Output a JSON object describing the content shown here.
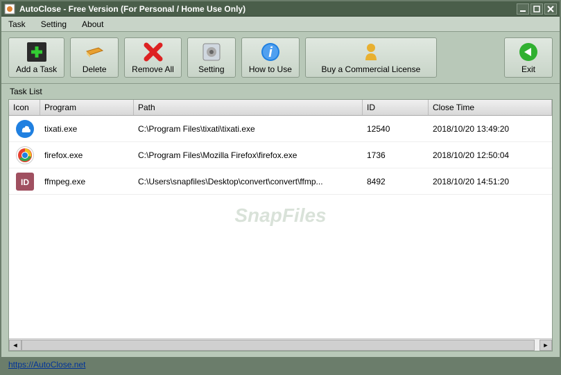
{
  "window": {
    "title": "AutoClose - Free Version (For Personal / Home Use Only)"
  },
  "menubar": {
    "items": [
      "Task",
      "Setting",
      "About"
    ]
  },
  "toolbar": {
    "add_task": "Add a Task",
    "delete": "Delete",
    "remove_all": "Remove All",
    "setting": "Setting",
    "how_to_use": "How to Use",
    "buy": "Buy a Commercial License",
    "exit": "Exit"
  },
  "task_list_label": "Task List",
  "columns": {
    "icon": "Icon",
    "program": "Program",
    "path": "Path",
    "id": "ID",
    "close_time": "Close Time"
  },
  "rows": [
    {
      "icon": "cloud",
      "program": "tixati.exe",
      "path": "C:\\Program Files\\tixati\\tixati.exe",
      "id": "12540",
      "close_time": "2018/10/20 13:49:20"
    },
    {
      "icon": "chrome",
      "program": "firefox.exe",
      "path": "C:\\Program Files\\Mozilla Firefox\\firefox.exe",
      "id": "1736",
      "close_time": "2018/10/20 12:50:04"
    },
    {
      "icon": "id",
      "program": "ffmpeg.exe",
      "path": "C:\\Users\\snapfiles\\Desktop\\convert\\convert\\ffmp...",
      "id": "8492",
      "close_time": "2018/10/20 14:51:20"
    }
  ],
  "watermark": "SnapFiles",
  "footer_link": "https://AutoClose.net"
}
